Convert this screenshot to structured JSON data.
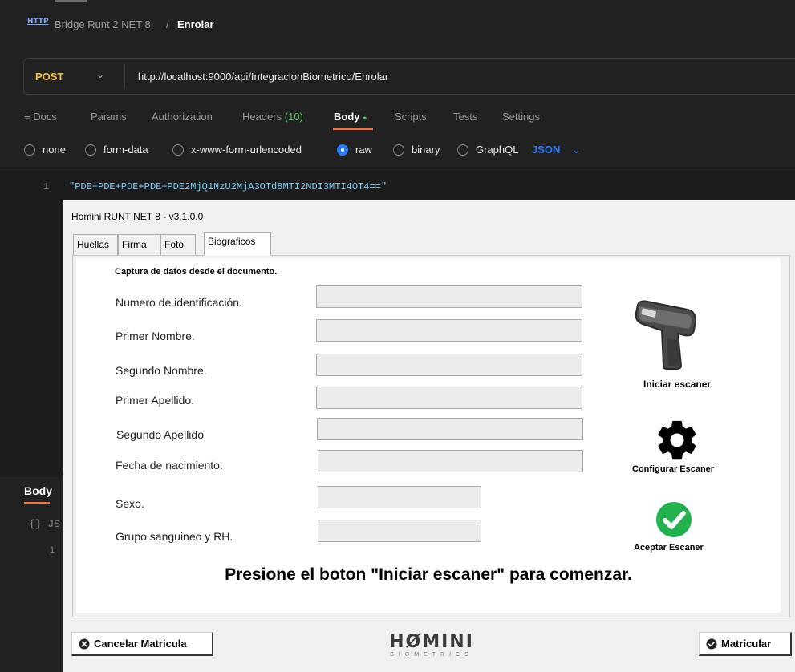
{
  "postman": {
    "breadcrumb_icon": "HTTP",
    "breadcrumb_parent": "Bridge Runt 2 NET 8",
    "breadcrumb_sep": "/",
    "breadcrumb_current": "Enrolar",
    "method": "POST",
    "url": "http://localhost:9000/api/IntegracionBiometrico/Enrolar",
    "tabs": {
      "docs": "≡ Docs",
      "params": "Params",
      "authorization": "Authorization",
      "headers": "Headers",
      "headers_count": "(10)",
      "body": "Body",
      "body_dot": "●",
      "scripts": "Scripts",
      "tests": "Tests",
      "settings": "Settings"
    },
    "body_types": [
      "none",
      "form-data",
      "x-www-form-urlencoded",
      "raw",
      "binary",
      "GraphQL"
    ],
    "selected_body_type": "raw",
    "format": "JSON",
    "line_number": "1",
    "code": "\"PDE+PDE+PDE+PDE+PDE2MjQ1NzU2MjA3OTd8MTI2NDI3MTI4OT4==\"",
    "response": {
      "label": "Body",
      "format_hint": "{} JS",
      "line_number": "1"
    },
    "colors": {
      "accent": "#ff6c37",
      "method": "#f5c143",
      "link": "#2b7bff"
    }
  },
  "homini": {
    "title": "Homini RUNT NET 8 - v3.1.0.0",
    "tabs": [
      "Huellas",
      "Firma",
      "Foto",
      "Biograficos"
    ],
    "active_tab": "Biograficos",
    "section_title": "Captura de datos desde el documento.",
    "fields": [
      {
        "label": "Numero de identificación.",
        "value": ""
      },
      {
        "label": "Primer Nombre.",
        "value": ""
      },
      {
        "label": "Segundo Nombre.",
        "value": ""
      },
      {
        "label": "Primer Apellido.",
        "value": ""
      },
      {
        "label": "Segundo Apellido",
        "value": ""
      },
      {
        "label": "Fecha de nacimiento.",
        "value": ""
      },
      {
        "label": "Sexo.",
        "value": ""
      },
      {
        "label": "Grupo sanguineo y RH.",
        "value": ""
      }
    ],
    "actions": {
      "start": "Iniciar escaner",
      "configure": "Configurar Escaner",
      "accept": "Aceptar Escaner"
    },
    "instruction": "Presione el boton \"Iniciar escaner\" para comenzar.",
    "cancel_button": "Cancelar Matricula",
    "enroll_button": "Matricular",
    "logo": {
      "main": "HØMINI",
      "sub": "BIOMETRICS"
    },
    "colors": {
      "accept": "#22b14c",
      "icon": "#000000"
    }
  }
}
